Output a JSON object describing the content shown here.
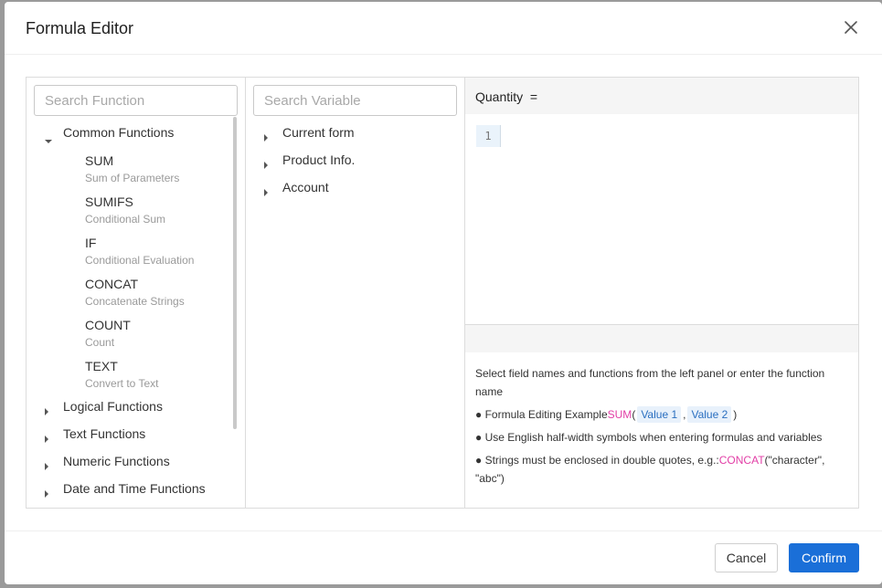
{
  "dialog": {
    "title": "Formula Editor",
    "close_icon": "close-icon"
  },
  "functions_panel": {
    "search_placeholder": "Search Function",
    "groups": [
      {
        "label": "Common Functions",
        "expanded": true,
        "items": [
          {
            "name": "SUM",
            "desc": "Sum of Parameters"
          },
          {
            "name": "SUMIFS",
            "desc": "Conditional Sum"
          },
          {
            "name": "IF",
            "desc": "Conditional Evaluation"
          },
          {
            "name": "CONCAT",
            "desc": "Concatenate Strings"
          },
          {
            "name": "COUNT",
            "desc": "Count"
          },
          {
            "name": "TEXT",
            "desc": "Convert to Text"
          }
        ]
      },
      {
        "label": "Logical Functions",
        "expanded": false
      },
      {
        "label": "Text Functions",
        "expanded": false
      },
      {
        "label": "Numeric Functions",
        "expanded": false
      },
      {
        "label": "Date and Time Functions",
        "expanded": false
      }
    ]
  },
  "variables_panel": {
    "search_placeholder": "Search Variable",
    "groups": [
      {
        "label": "Current form"
      },
      {
        "label": "Product Info."
      },
      {
        "label": "Account"
      }
    ]
  },
  "formula": {
    "field_label": "Quantity",
    "equals": "=",
    "line_number": "1"
  },
  "help": {
    "intro": "Select field names and functions from the left panel or enter the function name",
    "example_prefix": "● Formula Editing Example",
    "example_fn": "SUM",
    "example_open": "(",
    "example_arg1": "Value 1",
    "example_sep": ",",
    "example_arg2": "Value 2",
    "example_close": ")",
    "tip_symbols": "● Use English half-width symbols when entering formulas and variables",
    "tip_strings_prefix": "● Strings must be enclosed in double quotes, e.g.:",
    "tip_strings_fn": "CONCAT",
    "tip_strings_args": "(\"character\", \"abc\")"
  },
  "footer": {
    "cancel_label": "Cancel",
    "confirm_label": "Confirm"
  },
  "colors": {
    "primary": "#1a6fd8",
    "function_highlight": "#e23ea6",
    "variable_chip": "#2a6fc0"
  }
}
